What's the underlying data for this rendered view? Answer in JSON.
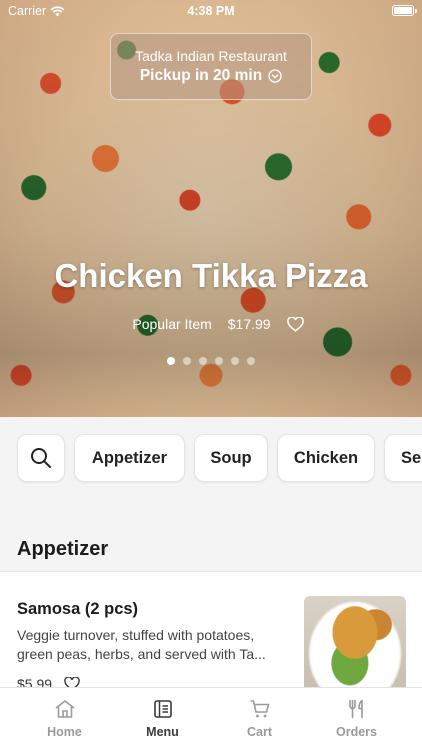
{
  "status_bar": {
    "carrier": "Carrier",
    "time": "4:38 PM"
  },
  "hero": {
    "restaurant_name": "Tadka Indian Restaurant",
    "pickup_label": "Pickup in 20 min",
    "title": "Chicken Tikka Pizza",
    "badge": "Popular Item",
    "price": "$17.99",
    "slides_total": 6,
    "slide_active": 1
  },
  "categories": [
    "Appetizer",
    "Soup",
    "Chicken",
    "Se"
  ],
  "section": {
    "title": "Appetizer",
    "item": {
      "name": "Samosa (2 pcs)",
      "description": "Veggie turnover, stuffed with potatoes, green peas, herbs, and served with Ta...",
      "price": "$5.99"
    }
  },
  "tabs": [
    {
      "label": "Home",
      "icon": "home-icon"
    },
    {
      "label": "Menu",
      "icon": "menu-icon",
      "active": true
    },
    {
      "label": "Cart",
      "icon": "cart-icon"
    },
    {
      "label": "Orders",
      "icon": "orders-icon"
    }
  ]
}
